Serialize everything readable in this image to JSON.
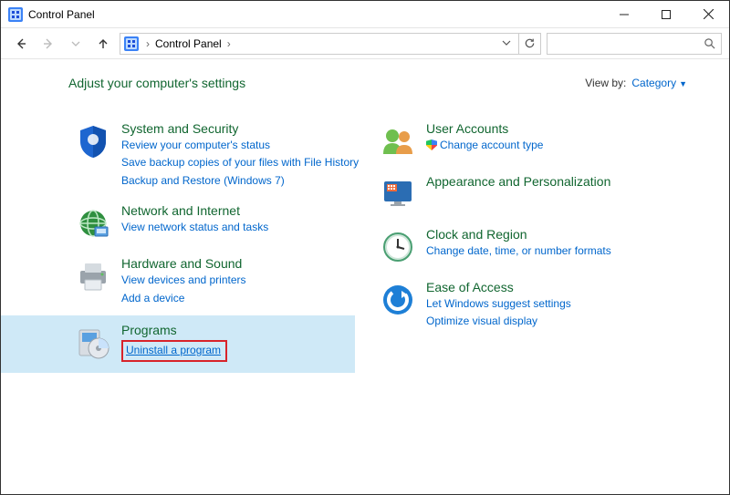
{
  "window": {
    "title": "Control Panel"
  },
  "breadcrumb": {
    "root": "Control Panel"
  },
  "header": {
    "heading": "Adjust your computer's settings",
    "viewby_label": "View by:",
    "viewby_value": "Category"
  },
  "left": {
    "system": {
      "title": "System and Security",
      "links": [
        "Review your computer's status",
        "Save backup copies of your files with File History",
        "Backup and Restore (Windows 7)"
      ]
    },
    "network": {
      "title": "Network and Internet",
      "links": [
        "View network status and tasks"
      ]
    },
    "hardware": {
      "title": "Hardware and Sound",
      "links": [
        "View devices and printers",
        "Add a device"
      ]
    },
    "programs": {
      "title": "Programs",
      "links": [
        "Uninstall a program"
      ]
    }
  },
  "right": {
    "users": {
      "title": "User Accounts",
      "links": [
        "Change account type"
      ]
    },
    "appearance": {
      "title": "Appearance and Personalization"
    },
    "clock": {
      "title": "Clock and Region",
      "links": [
        "Change date, time, or number formats"
      ]
    },
    "ease": {
      "title": "Ease of Access",
      "links": [
        "Let Windows suggest settings",
        "Optimize visual display"
      ]
    }
  }
}
